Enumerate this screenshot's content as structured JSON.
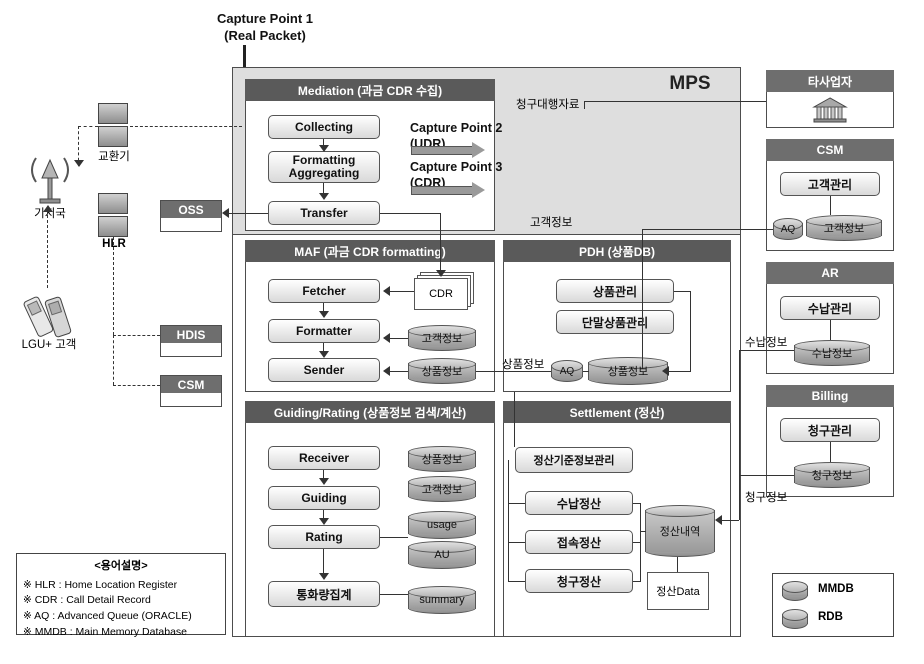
{
  "title": "MPS",
  "capture_points": {
    "cp1_line1": "Capture Point 1",
    "cp1_line2": "(Real Packet)",
    "cp2_line1": "Capture Point 2",
    "cp2_line2": "(UDR)",
    "cp3_line1": "Capture Point 3",
    "cp3_line2": "(CDR)"
  },
  "left": {
    "bs_label": "기지국",
    "switch_label": "교환기",
    "hlr_label": "HLR",
    "customer_label": "LGU+ 고객",
    "oss": "OSS",
    "hdis": "HDIS",
    "csm": "CSM"
  },
  "mediation": {
    "header": "Mediation (과금 CDR 수집)",
    "nodes": [
      "Collecting",
      "Formatting\nAggregating",
      "Transfer"
    ]
  },
  "maf": {
    "header": "MAF (과금 CDR formatting)",
    "nodes": [
      "Fetcher",
      "Formatter",
      "Sender"
    ],
    "doc": "CDR",
    "db1": "고객정보",
    "db2": "상품정보"
  },
  "guiding": {
    "header": "Guiding/Rating (상품정보 검색/계산)",
    "nodes": [
      "Receiver",
      "Guiding",
      "Rating",
      "통화량집계"
    ],
    "db1": "상품정보",
    "db2": "고객정보",
    "db3": "usage",
    "db4": "AU",
    "db5": "summary"
  },
  "pdh": {
    "header": "PDH (상품DB)",
    "nodes": [
      "상품관리",
      "단말상품관리"
    ],
    "aq": "AQ",
    "db": "상품정보",
    "label_in": "상품정보"
  },
  "settlement": {
    "header": "Settlement (정산)",
    "nodes": [
      "정산기준정보관리",
      "수납정산",
      "접속정산",
      "청구정산"
    ],
    "db": "정산내역",
    "doc": "정산Data"
  },
  "mps_labels": {
    "claim_agency": "청구대행자료",
    "customer_info": "고객정보"
  },
  "right": {
    "other_carrier": {
      "header": "타사업자"
    },
    "csm": {
      "header": "CSM",
      "node": "고객관리",
      "aq": "AQ",
      "db": "고객정보"
    },
    "ar": {
      "header": "AR",
      "node": "수납관리",
      "db": "수납정보",
      "edge": "수납정보"
    },
    "billing": {
      "header": "Billing",
      "node": "청구관리",
      "db": "청구정보",
      "edge": "청구정보"
    }
  },
  "legend_terms": {
    "title": "<용어설명>",
    "lines": [
      "※ HLR : Home Location Register",
      "※ CDR : Call Detail Record",
      "※ AQ : Advanced Queue (ORACLE)",
      "※ MMDB : Main Memory Database"
    ]
  },
  "legend_db": {
    "mmdb": "MMDB",
    "rdb": "RDB"
  }
}
